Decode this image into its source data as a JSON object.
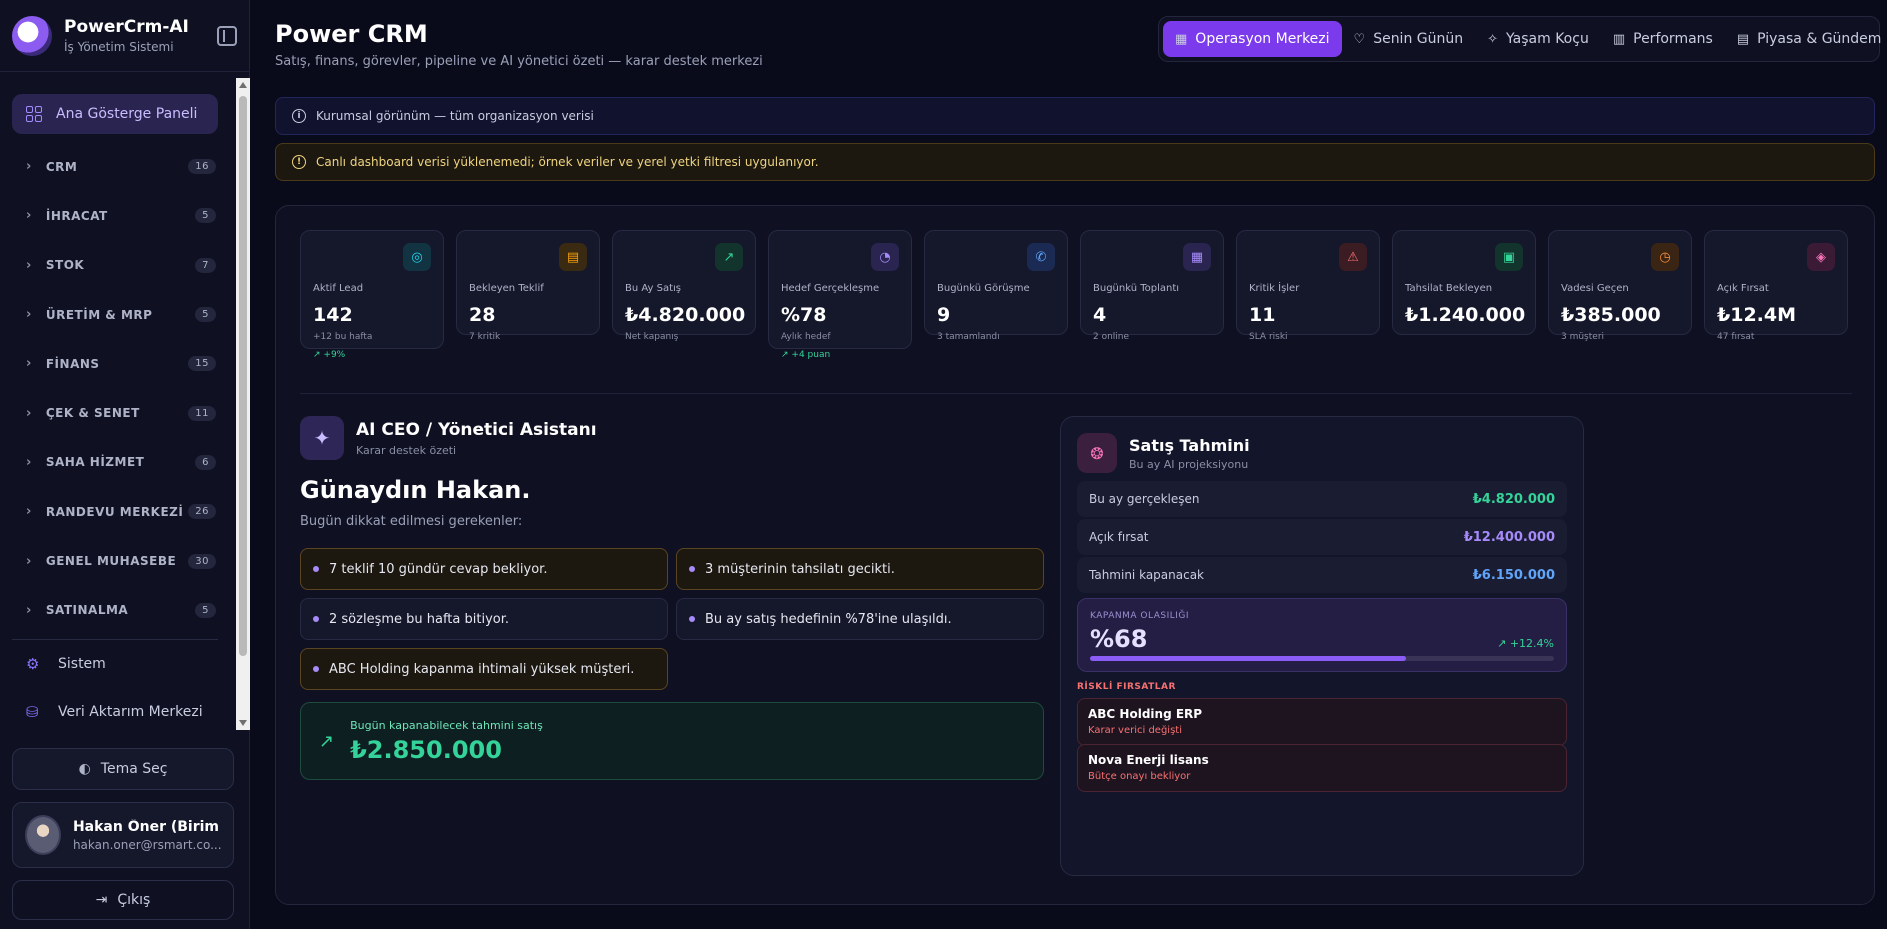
{
  "brand": {
    "title": "PowerCrm-AI",
    "subtitle": "İş Yönetim Sistemi"
  },
  "sidebar": {
    "active_item": "Ana Gösterge Paneli",
    "items": [
      {
        "label": "CRM",
        "count": "16"
      },
      {
        "label": "İHRACAT",
        "count": "5"
      },
      {
        "label": "STOK",
        "count": "7"
      },
      {
        "label": "ÜRETİM & MRP",
        "count": "5"
      },
      {
        "label": "FİNANS",
        "count": "15"
      },
      {
        "label": "ÇEK & SENET",
        "count": "11"
      },
      {
        "label": "SAHA HİZMET",
        "count": "6"
      },
      {
        "label": "RANDEVU MERKEZİ",
        "count": "26"
      },
      {
        "label": "GENEL MUHASEBE",
        "count": "30"
      },
      {
        "label": "SATINALMA",
        "count": "5"
      }
    ],
    "system_items": [
      "Sistem",
      "Veri Aktarım Merkezi"
    ],
    "theme_button": "Tema Seç",
    "user": {
      "name": "Hakan Öner (Birim ...",
      "email": "hakan.oner@rsmart.co..."
    },
    "logout": "Çıkış"
  },
  "header": {
    "title": "Power CRM",
    "subtitle": "Satış, finans, görevler, pipeline ve AI yönetici özeti — karar destek merkezi",
    "tabs": [
      {
        "label": "Operasyon Merkezi",
        "icon": "grid-icon",
        "active": true
      },
      {
        "label": "Senin Günün",
        "icon": "heart-icon",
        "active": false
      },
      {
        "label": "Yaşam Koçu",
        "icon": "sparkle-icon",
        "active": false
      },
      {
        "label": "Performans",
        "icon": "bar-chart-icon",
        "active": false
      },
      {
        "label": "Piyasa & Gündem",
        "icon": "newspaper-icon",
        "active": false
      }
    ]
  },
  "info_bar": "Kurumsal görünüm — tüm organizasyon verisi",
  "warning_bar": "Canlı dashboard verisi yüklenemedi; örnek veriler ve yerel yetki filtresi uygulanıyor.",
  "kpis": [
    {
      "label": "Aktif Lead",
      "value": "142",
      "sub": "+12 bu hafta",
      "trend": "+9%",
      "icon": "target-icon",
      "color": "#22d3ee",
      "bg": "#123442"
    },
    {
      "label": "Bekleyen Teklif",
      "value": "28",
      "sub": "7 kritik",
      "trend": "",
      "icon": "document-icon",
      "color": "#f59e0b",
      "bg": "#3a2a12"
    },
    {
      "label": "Bu Ay Satış",
      "value": "₺4.820.000",
      "sub": "Net kapanış",
      "trend": "",
      "icon": "trend-up-icon",
      "color": "#34d399",
      "bg": "#12342c"
    },
    {
      "label": "Hedef Gerçekleşme",
      "value": "%78",
      "sub": "Aylık hedef",
      "trend": "+4 puan",
      "icon": "gauge-icon",
      "color": "#a78bfa",
      "bg": "#2a2450"
    },
    {
      "label": "Bugünkü Görüşme",
      "value": "9",
      "sub": "3 tamamlandı",
      "trend": "",
      "icon": "phone-icon",
      "color": "#60a5fa",
      "bg": "#1a2a52"
    },
    {
      "label": "Bugünkü Toplantı",
      "value": "4",
      "sub": "2 online",
      "trend": "",
      "icon": "calendar-icon",
      "color": "#a78bfa",
      "bg": "#2a2450"
    },
    {
      "label": "Kritik İşler",
      "value": "11",
      "sub": "SLA riski",
      "trend": "",
      "icon": "alert-icon",
      "color": "#f87171",
      "bg": "#3a1c22"
    },
    {
      "label": "Tahsilat Bekleyen",
      "value": "₺1.240.000",
      "sub": "",
      "trend": "",
      "icon": "wallet-icon",
      "color": "#34d399",
      "bg": "#12342c"
    },
    {
      "label": "Vadesi Geçen",
      "value": "₺385.000",
      "sub": "3 müşteri",
      "trend": "",
      "icon": "clock-icon",
      "color": "#fb923c",
      "bg": "#3a2414"
    },
    {
      "label": "Açık Fırsat",
      "value": "₺12.4M",
      "sub": "47 fırsat",
      "trend": "",
      "icon": "layers-icon",
      "color": "#f472b6",
      "bg": "#3a1a34"
    }
  ],
  "ai_ceo": {
    "title": "AI CEO / Yönetici Asistanı",
    "subtitle": "Karar destek özeti",
    "greeting": "Günaydın Hakan.",
    "prompt": "Bugün dikkat edilmesi gerekenler:",
    "alerts": [
      {
        "text": "7 teklif 10 gündür cevap bekliyor.",
        "warn": true
      },
      {
        "text": "3 müşterinin tahsilatı gecikti.",
        "warn": true
      },
      {
        "text": "2 sözleşme bu hafta bitiyor.",
        "warn": false
      },
      {
        "text": "Bu ay satış hedefinin %78'ine ulaşıldı.",
        "warn": false
      },
      {
        "text": "ABC Holding kapanma ihtimali yüksek müşteri.",
        "warn": true
      }
    ],
    "forecast_label": "Bugün kapanabilecek tahmini satış",
    "forecast_value": "₺2.850.000"
  },
  "sales_forecast": {
    "title": "Satış Tahmini",
    "subtitle": "Bu ay AI projeksiyonu",
    "rows": [
      {
        "label": "Bu ay gerçekleşen",
        "value": "₺4.820.000",
        "color": "#34d399"
      },
      {
        "label": "Açık fırsat",
        "value": "₺12.400.000",
        "color": "#a78bfa"
      },
      {
        "label": "Tahmini kapanacak",
        "value": "₺6.150.000",
        "color": "#60a5fa"
      }
    ],
    "probability_label": "KAPANMA OLASILIĞI",
    "probability_value": "%68",
    "probability_fraction": 0.68,
    "probability_trend": "+12.4%",
    "risk_title": "RİSKLİ FIRSATLAR",
    "risks": [
      {
        "name": "ABC Holding ERP",
        "note": "Karar verici değişti"
      },
      {
        "name": "Nova Enerji lisans",
        "note": "Bütçe onayı bekliyor"
      }
    ]
  }
}
